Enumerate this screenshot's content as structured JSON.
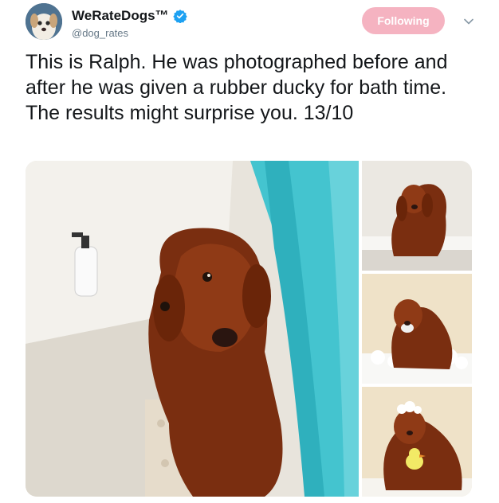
{
  "tweet": {
    "author": {
      "display_name": "WeRateDogs™",
      "handle": "@dog_rates",
      "verified": true,
      "verified_icon": "verified-badge-icon",
      "avatar_icon": "dog-avatar"
    },
    "follow_button": {
      "label": "Following",
      "color": "#f5b3c1"
    },
    "menu_icon": "chevron-down-icon",
    "text": "This is Ralph. He was photographed before and after he was given a rubber ducky for bath time. The results might surprise you. 13/10",
    "media": [
      {
        "icon": "dog-shower-curtain-photo"
      },
      {
        "icon": "dog-bathtub-photo"
      },
      {
        "icon": "dog-bubbles-photo"
      },
      {
        "icon": "dog-rubber-ducky-photo"
      }
    ]
  },
  "colors": {
    "accent": "#1da1f2",
    "text": "#14171a",
    "secondary_text": "#657786",
    "fur": "#7a2e10"
  }
}
